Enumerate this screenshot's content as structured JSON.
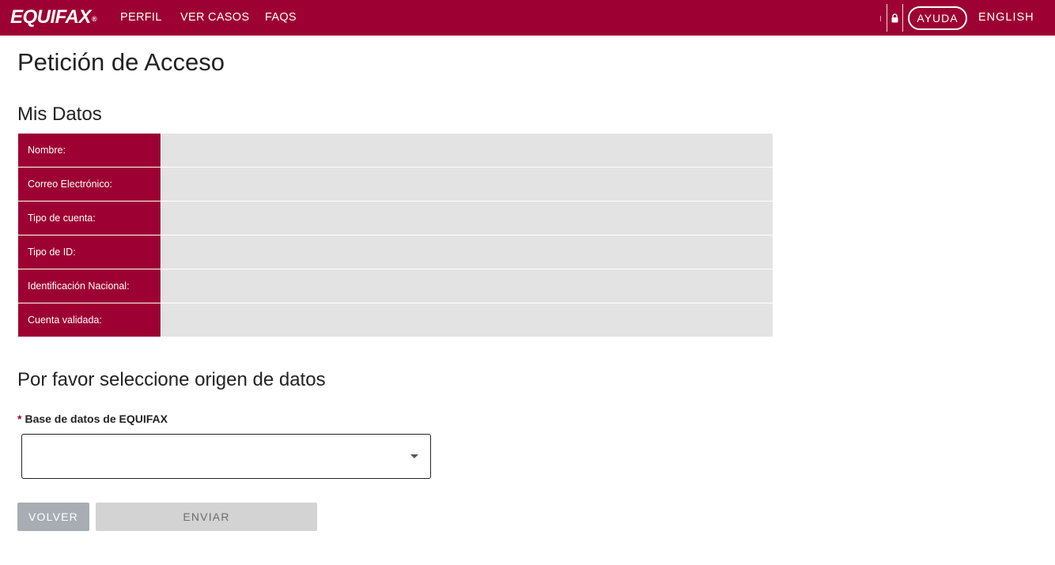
{
  "header": {
    "logo_text": "EQUIFAX",
    "logo_mark": "®",
    "nav": [
      {
        "label": "PERFIL"
      },
      {
        "label": "VER CASOS"
      },
      {
        "label": "FAQS"
      }
    ],
    "help_label": "AYUDA",
    "language_label": "ENGLISH",
    "lock_icon": "lock-icon",
    "brand_color": "#9d0033"
  },
  "page": {
    "title": "Petición de Acceso",
    "my_data_title": "Mis Datos",
    "rows": [
      {
        "label": "Nombre:",
        "value": ""
      },
      {
        "label": "Correo Electrónico:",
        "value": ""
      },
      {
        "label": "Tipo de cuenta:",
        "value": ""
      },
      {
        "label": "Tipo de ID:",
        "value": ""
      },
      {
        "label": "Identificación Nacional:",
        "value": ""
      },
      {
        "label": "Cuenta validada:",
        "value": ""
      }
    ],
    "source_title": "Por favor seleccione origen de datos",
    "source_field": {
      "required_mark": "*",
      "label": "Base de datos de EQUIFAX",
      "selected_value": ""
    },
    "buttons": {
      "back_label": "VOLVER",
      "submit_label": "ENVIAR"
    }
  }
}
